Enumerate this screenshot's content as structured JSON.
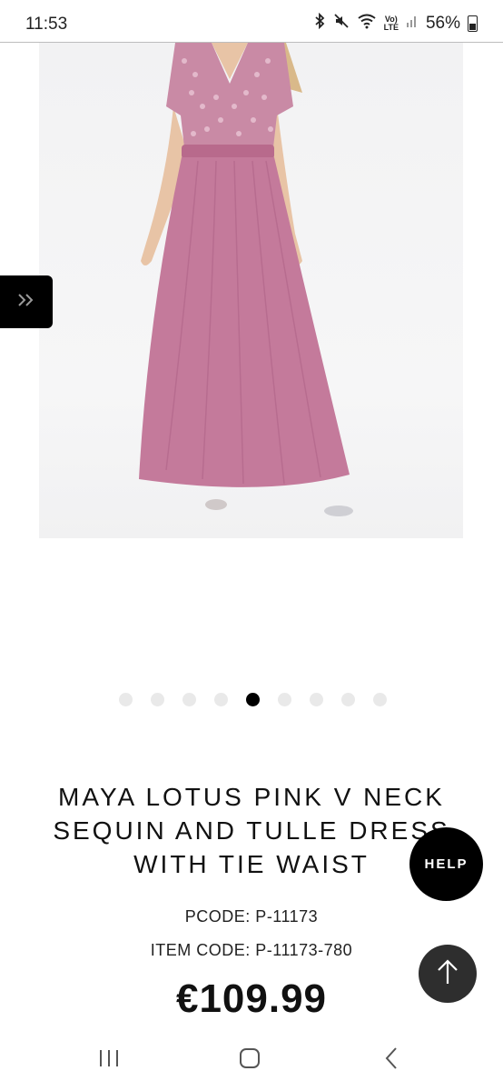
{
  "status_bar": {
    "time": "11:53",
    "lte_top": "Vo)",
    "lte_bottom": "LTE",
    "battery": "56%"
  },
  "gallery": {
    "image_alt": "Maya lotus pink V neck sequin and tulle dress",
    "dot_count": 9,
    "active_index": 4
  },
  "side_tab": {
    "icon": "double-chevron-right"
  },
  "product": {
    "title_line1": "MAYA LOTUS PINK V NECK",
    "title_line2": "SEQUIN AND TULLE DRESS",
    "title_line3": "WITH TIE WAIST",
    "pcode": "PCODE: P-11173",
    "item_code": "ITEM CODE: P-11173-780",
    "price": "€109.99"
  },
  "help_button": {
    "label": "HELP"
  },
  "scroll_top": {
    "icon": "arrow-up"
  },
  "colors": {
    "dress": "#c47a9b",
    "sequin": "#d8a3b8",
    "black": "#000000"
  }
}
